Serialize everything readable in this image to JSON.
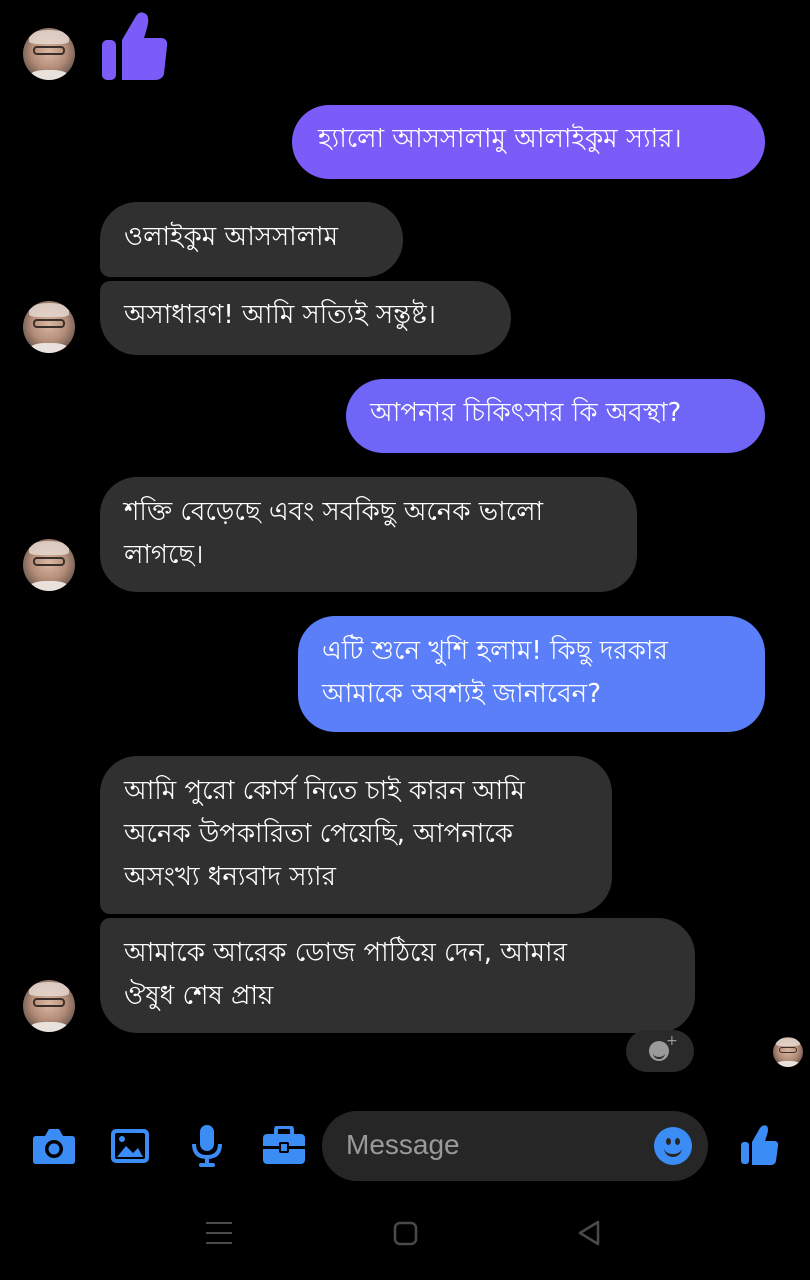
{
  "messages": [
    {
      "direction": "incoming-sticker",
      "sticker": "thumbs-up-icon"
    },
    {
      "direction": "outgoing",
      "text": "হ্যালো আসসালামু আলাইকুম স্যার।"
    },
    {
      "direction": "incoming",
      "text": "ওলাইকুম আসসালাম"
    },
    {
      "direction": "incoming",
      "text": "অসাধারণ! আমি সত্যিই সন্তুষ্ট।"
    },
    {
      "direction": "outgoing",
      "text": "আপনার চিকিৎসার কি অবস্থা?"
    },
    {
      "direction": "incoming",
      "lines": [
        "শক্তি বেড়েছে এবং সবকিছু অনেক ভালো",
        "লাগছে।"
      ]
    },
    {
      "direction": "outgoing",
      "lines": [
        "এটি শুনে খুশি হলাম! কিছু  দরকার",
        "আমাকে অবশ্যই জানাবেন?"
      ]
    },
    {
      "direction": "incoming",
      "lines": [
        "আমি পুরো কোর্স নিতে চাই কারন আমি",
        "অনেক উপকারিতা পেয়েছি, আপনাকে",
        "অসংখ্য ধন্যবাদ স্যার"
      ]
    },
    {
      "direction": "incoming",
      "lines": [
        "আমাকে আরেক ডোজ পাঠিয়ে দেন, আমার",
        "ঔষুধ শেষ প্রায়"
      ]
    }
  ],
  "composer": {
    "placeholder": "Message",
    "icons": [
      "camera-icon",
      "gallery-icon",
      "microphone-icon",
      "briefcase-icon",
      "emoji-icon",
      "thumbs-up-icon"
    ]
  },
  "colors": {
    "background": "#000000",
    "incoming_bubble": "#303030",
    "outgoing_bubble_top": "#7c5cf8",
    "outgoing_bubble_bottom": "#5b7ef9",
    "accent": "#3b8cf5"
  }
}
